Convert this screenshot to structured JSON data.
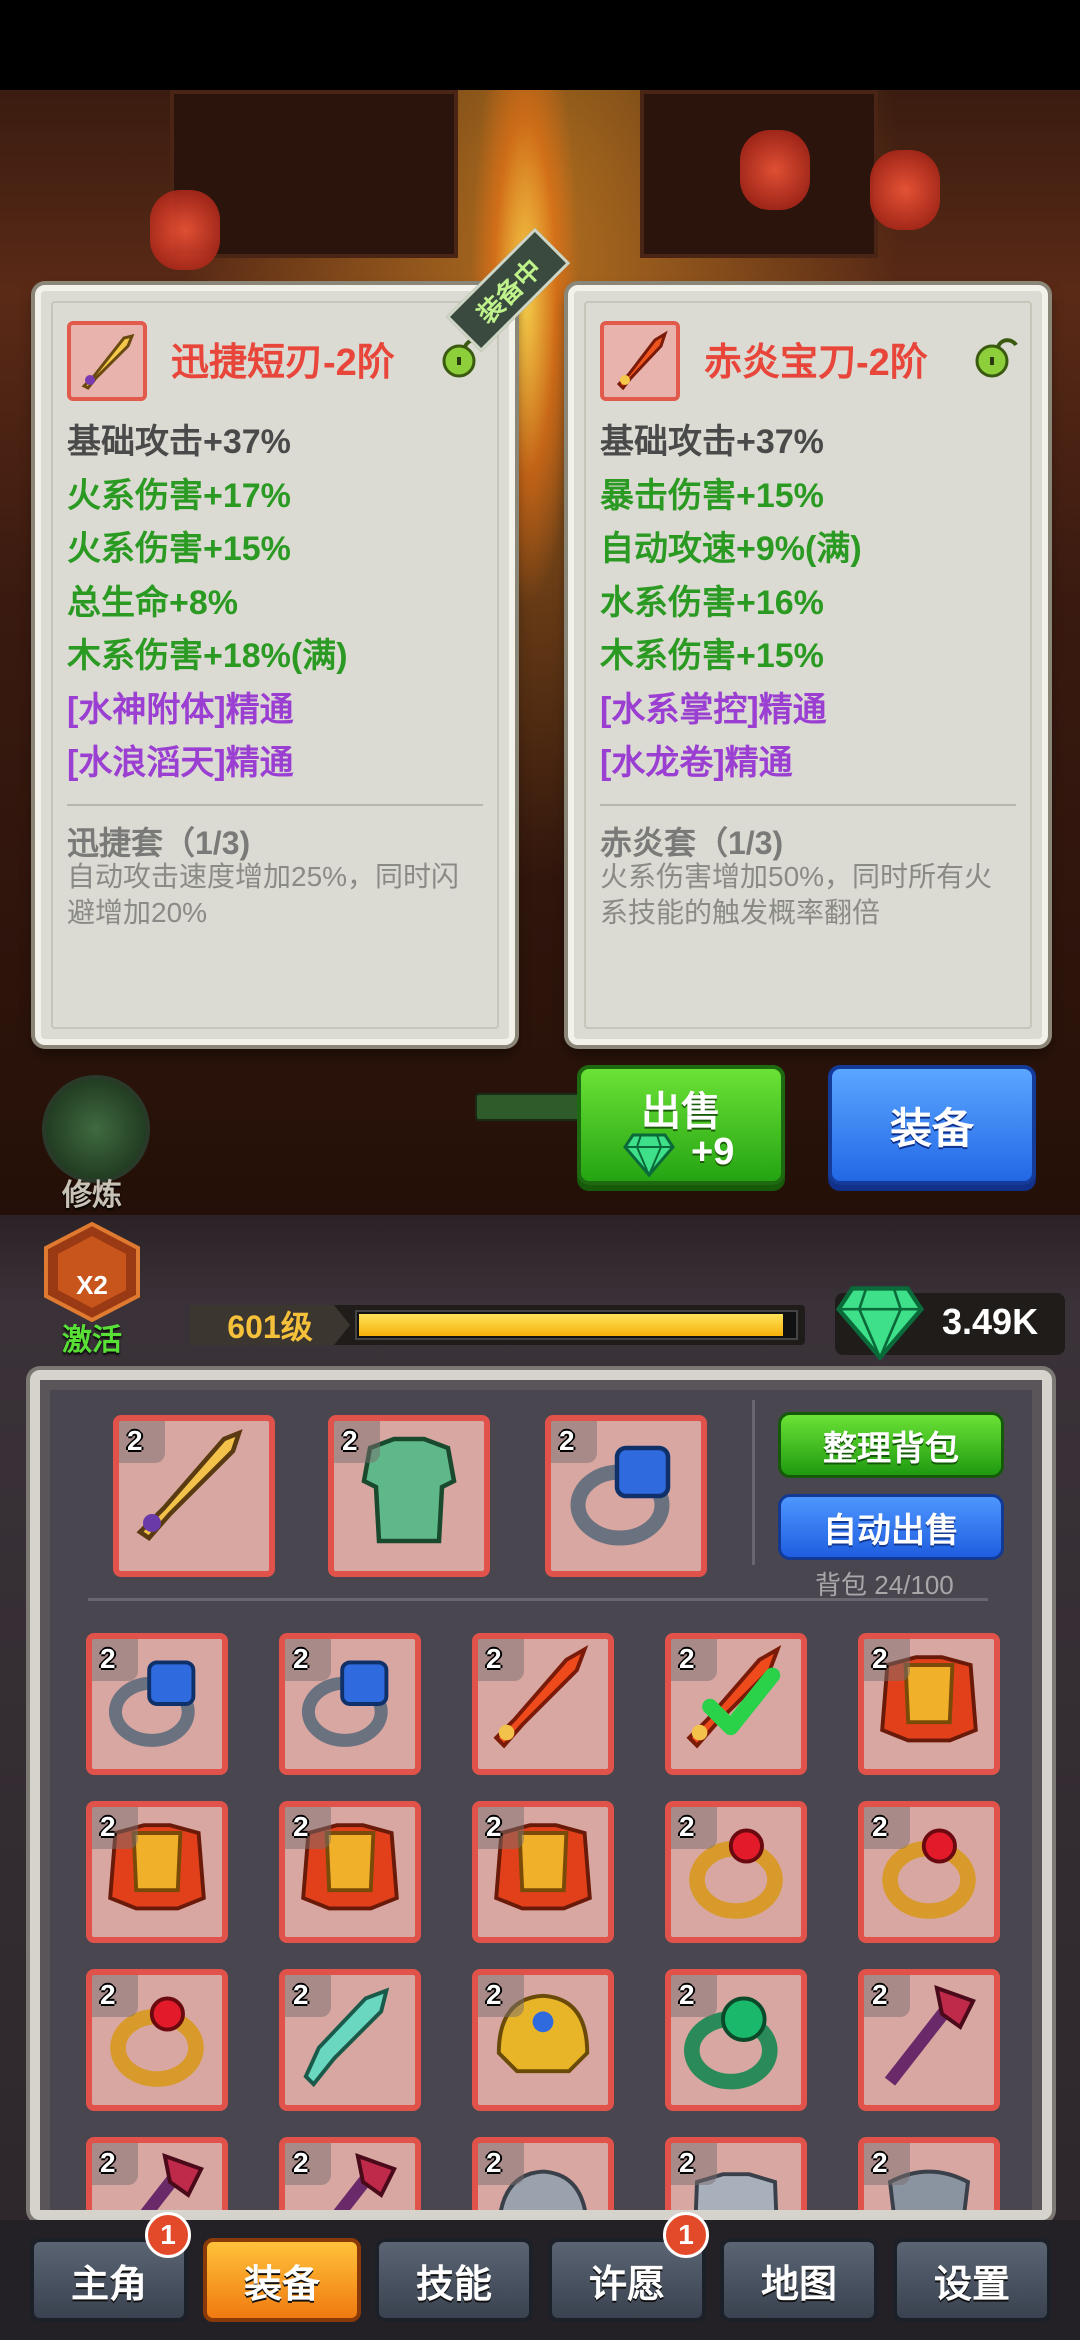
{
  "equipped_tag": "装备中",
  "left_card": {
    "title": "迅捷短刃-2阶",
    "stats": [
      {
        "text": "基础攻击+37%",
        "kind": "base"
      },
      {
        "text": "火系伤害+17%",
        "kind": "green"
      },
      {
        "text": "火系伤害+15%",
        "kind": "green"
      },
      {
        "text": "总生命+8%",
        "kind": "green"
      },
      {
        "text": "木系伤害+18%(满)",
        "kind": "green"
      },
      {
        "text": "[水神附体]精通",
        "kind": "purple"
      },
      {
        "text": "[水浪滔天]精通",
        "kind": "purple"
      }
    ],
    "set_title": "迅捷套（1/3)",
    "set_desc": "自动攻击速度增加25%，同时闪避增加20%"
  },
  "right_card": {
    "title": "赤炎宝刀-2阶",
    "stats": [
      {
        "text": "基础攻击+37%",
        "kind": "base"
      },
      {
        "text": "暴击伤害+15%",
        "kind": "green"
      },
      {
        "text": "自动攻速+9%(满)",
        "kind": "green"
      },
      {
        "text": "水系伤害+16%",
        "kind": "green"
      },
      {
        "text": "木系伤害+15%",
        "kind": "green"
      },
      {
        "text": "[水系掌控]精通",
        "kind": "purple"
      },
      {
        "text": "[水龙卷]精通",
        "kind": "purple"
      }
    ],
    "set_title": "赤炎套（1/3)",
    "set_desc": "火系伤害增加50%，同时所有火系技能的触发概率翻倍"
  },
  "side": {
    "cultivate_label": "修炼",
    "activate_label": "激活",
    "activate_multiplier": "X2"
  },
  "actions": {
    "sell_label": "出售",
    "sell_amount": "+9",
    "equip_label": "装备"
  },
  "player": {
    "level_label": "601级",
    "xp_fraction": 0.97,
    "gems": "3.49K"
  },
  "bag": {
    "sort_label": "整理背包",
    "auto_sell_label": "自动出售",
    "capacity": "背包 24/100",
    "equipped": [
      {
        "tier": "2",
        "icon": "golden-dagger-icon"
      },
      {
        "tier": "2",
        "icon": "jade-armor-icon"
      },
      {
        "tier": "2",
        "icon": "sapphire-ring-icon"
      }
    ],
    "items": [
      {
        "tier": "2",
        "icon": "sapphire-ring-icon"
      },
      {
        "tier": "2",
        "icon": "sapphire-ring-icon"
      },
      {
        "tier": "2",
        "icon": "flame-sword-icon"
      },
      {
        "tier": "2",
        "icon": "flame-sword-icon",
        "checked": true
      },
      {
        "tier": "2",
        "icon": "gold-armor-icon"
      },
      {
        "tier": "2",
        "icon": "gold-armor-icon"
      },
      {
        "tier": "2",
        "icon": "gold-armor-icon"
      },
      {
        "tier": "2",
        "icon": "gold-armor-icon"
      },
      {
        "tier": "2",
        "icon": "ruby-ring-icon"
      },
      {
        "tier": "2",
        "icon": "ruby-ring-icon"
      },
      {
        "tier": "2",
        "icon": "ruby-ring-icon"
      },
      {
        "tier": "2",
        "icon": "jade-sword-icon"
      },
      {
        "tier": "2",
        "icon": "gold-helmet-icon"
      },
      {
        "tier": "2",
        "icon": "emerald-ring-icon"
      },
      {
        "tier": "2",
        "icon": "dragon-staff-icon"
      },
      {
        "tier": "2",
        "icon": "dragon-staff-icon"
      },
      {
        "tier": "2",
        "icon": "dragon-staff-icon"
      },
      {
        "tier": "2",
        "icon": "iron-helmet-icon"
      },
      {
        "tier": "2",
        "icon": "iron-armor-icon"
      },
      {
        "tier": "2",
        "icon": "iron-shield-icon"
      }
    ]
  },
  "nav": {
    "tabs": [
      {
        "label": "主角",
        "badge": "1"
      },
      {
        "label": "装备",
        "active": true
      },
      {
        "label": "技能"
      },
      {
        "label": "许愿",
        "badge": "1"
      },
      {
        "label": "地图"
      },
      {
        "label": "设置"
      }
    ]
  },
  "colors": {
    "title_red": "#e8463a",
    "stat_green": "#2a9a22",
    "stat_purple": "#9a3fd2",
    "slot_border": "#e0524a",
    "tab_active": "#f5a020"
  }
}
